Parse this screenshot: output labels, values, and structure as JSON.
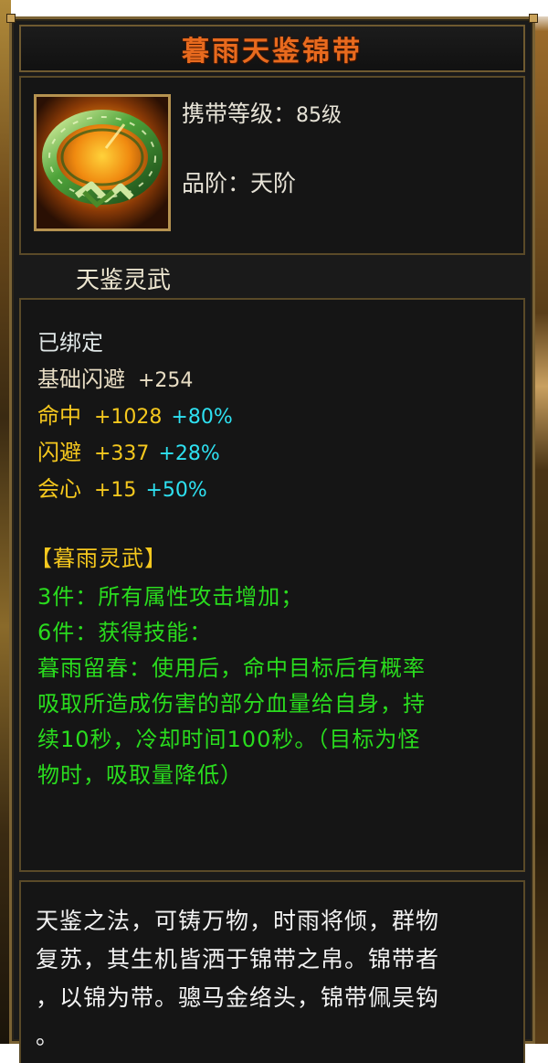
{
  "item": {
    "name": "暮雨天鉴锦带",
    "level_label": "携带等级：",
    "level_value": "85级",
    "grade_label": "品阶：",
    "grade_value": "天阶",
    "series_name": "天鉴灵武",
    "icon": "jade-belt-ring-icon"
  },
  "stats": {
    "bound": "已绑定",
    "base_dodge": {
      "label": "基础闪避",
      "value": "+254"
    },
    "hit": {
      "label": "命中",
      "value": "+1028",
      "bonus": "+80%"
    },
    "dodge": {
      "label": "闪避",
      "value": "+337",
      "bonus": "+28%"
    },
    "crit": {
      "label": "会心",
      "value": "+15",
      "bonus": "+50%"
    }
  },
  "set": {
    "title": "【暮雨灵武】",
    "bonus3": "3件：所有属性攻击增加；",
    "bonus6": "6件：获得技能：",
    "skill_line1": "暮雨留春：使用后，命中目标后有概率",
    "skill_line2": "吸取所造成伤害的部分血量给自身，持",
    "skill_line3": "续10秒，冷却时间100秒。（目标为怪",
    "skill_line4": "物时，吸取量降低）"
  },
  "description": {
    "line1": "天鉴之法，可铸万物，时雨将倾，群物",
    "line2": "复苏，其生机皆洒于锦带之帛。锦带者",
    "line3": "，以锦为带。骢马金络头，锦带佩吴钩",
    "line4": "。"
  },
  "colors": {
    "title": "#e86a1e",
    "stat_gold": "#f5c81e",
    "stat_bonus_cyan": "#2ee0f0",
    "set_green": "#2adc1e",
    "frame_gold": "#7a6234"
  }
}
